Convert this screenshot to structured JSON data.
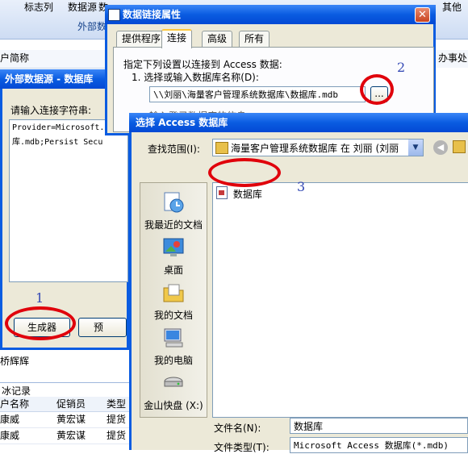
{
  "background": {
    "ribbon_tabs": [
      "标志列",
      "数据源",
      "数",
      "其他"
    ],
    "ribbon_group": "外部数",
    "col_customer_short": "户简称",
    "col_office": "办事处",
    "row_name": "桥辉辉",
    "bottom_title": "冰记录",
    "bottom_headers": [
      "户名称",
      "促销员",
      "类型"
    ],
    "bottom_rows": [
      [
        "康威",
        "黄宏谋",
        "提货"
      ],
      [
        "康威",
        "黄宏谋",
        "提货"
      ]
    ]
  },
  "external_dialog": {
    "title": "外部数据源 - 数据库",
    "prompt": "请输入连接字符串:",
    "conn_line1": "Provider=Microsoft.",
    "conn_line2": "库.mdb;Persist Secu",
    "generator_button": "生成器",
    "preview_button": "预"
  },
  "datalink_dialog": {
    "title": "数据链接属性",
    "tabs": [
      "提供程序",
      "连接",
      "高级",
      "所有"
    ],
    "instruction": "指定下列设置以连接到 Access 数据:",
    "step1": "1. 选择或输入数据库名称(D):",
    "db_path": "\\\\刘丽\\海量客户管理系统数据库\\数据库.mdb",
    "browse_button": "...",
    "step2_partial": "输入登录数据库的信息"
  },
  "access_dialog": {
    "title": "选择 Access 数据库",
    "lookin_label": "查找范围(I):",
    "lookin_value": "海量客户管理系统数据库 在 刘丽 (刘丽",
    "places": [
      "我最近的文档",
      "桌面",
      "我的文档",
      "我的电脑",
      "金山快盘 (X:)"
    ],
    "files": [
      "数据库"
    ],
    "filename_label": "文件名(N):",
    "filename_value": "数据库",
    "filetype_label": "文件类型(T):",
    "filetype_value": "Microsoft Access 数据库(*.mdb)"
  },
  "annotations": [
    "1",
    "2",
    "3"
  ],
  "colors": {
    "annotation_ring": "#e0000b",
    "annotation_number": "#3348b4",
    "xp_title": "#0a5ce1",
    "dialog_face": "#ece9d8"
  }
}
